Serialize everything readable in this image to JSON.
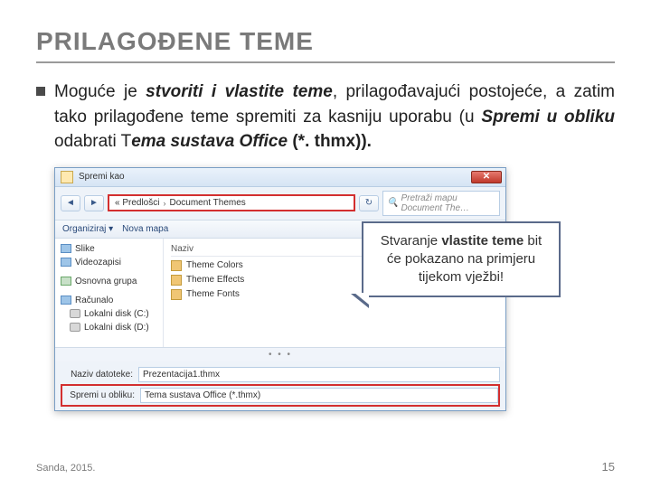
{
  "title": "PRILAGOĐENE TEME",
  "para": {
    "p1": "Moguće je ",
    "p2": "stvoriti i vlastite teme",
    "p3": ", prilagođavajući postojeće, a zatim tako prilagođene teme spremiti za kasniju uporabu (u ",
    "p4": "Spremi u obliku",
    "p5": " odabrati T",
    "p6": "ema sustava Office",
    "p7": " (*. thmx)).",
    "p5b": ""
  },
  "dialog": {
    "title": "Spremi kao",
    "close": "✕",
    "nav_back": "◄",
    "nav_fwd": "►",
    "breadcrumb": {
      "a": "« Predlošci",
      "sep": "›",
      "b": "Document Themes"
    },
    "refresh": "↻",
    "search_placeholder": "Pretraži mapu Document The…",
    "toolbar": {
      "organize": "Organiziraj ▾",
      "newfolder": "Nova mapa"
    },
    "sidebar": [
      {
        "icon": "blue",
        "label": "Slike"
      },
      {
        "icon": "blue",
        "label": "Videozapisi"
      },
      {
        "icon": "net",
        "label": "Osnovna grupa"
      },
      {
        "icon": "blue",
        "label": "Računalo"
      },
      {
        "icon": "disk",
        "label": "Lokalni disk (C:)"
      },
      {
        "icon": "disk",
        "label": "Lokalni disk (D:)"
      }
    ],
    "colhead": "Naziv",
    "files": [
      "Theme Colors",
      "Theme Effects",
      "Theme Fonts"
    ],
    "filename_label": "Naziv datoteke:",
    "filename_value": "Prezentacija1.thmx",
    "savetype_label": "Spremi u obliku:",
    "savetype_value": "Tema sustava Office (*.thmx)"
  },
  "callout": {
    "l1": "Stvaranje ",
    "l2": "vlastite teme",
    "l3": " bit će pokazano na primjeru tijekom vježbi!"
  },
  "footer": {
    "left": "Sanda, 2015.",
    "right": "15"
  }
}
